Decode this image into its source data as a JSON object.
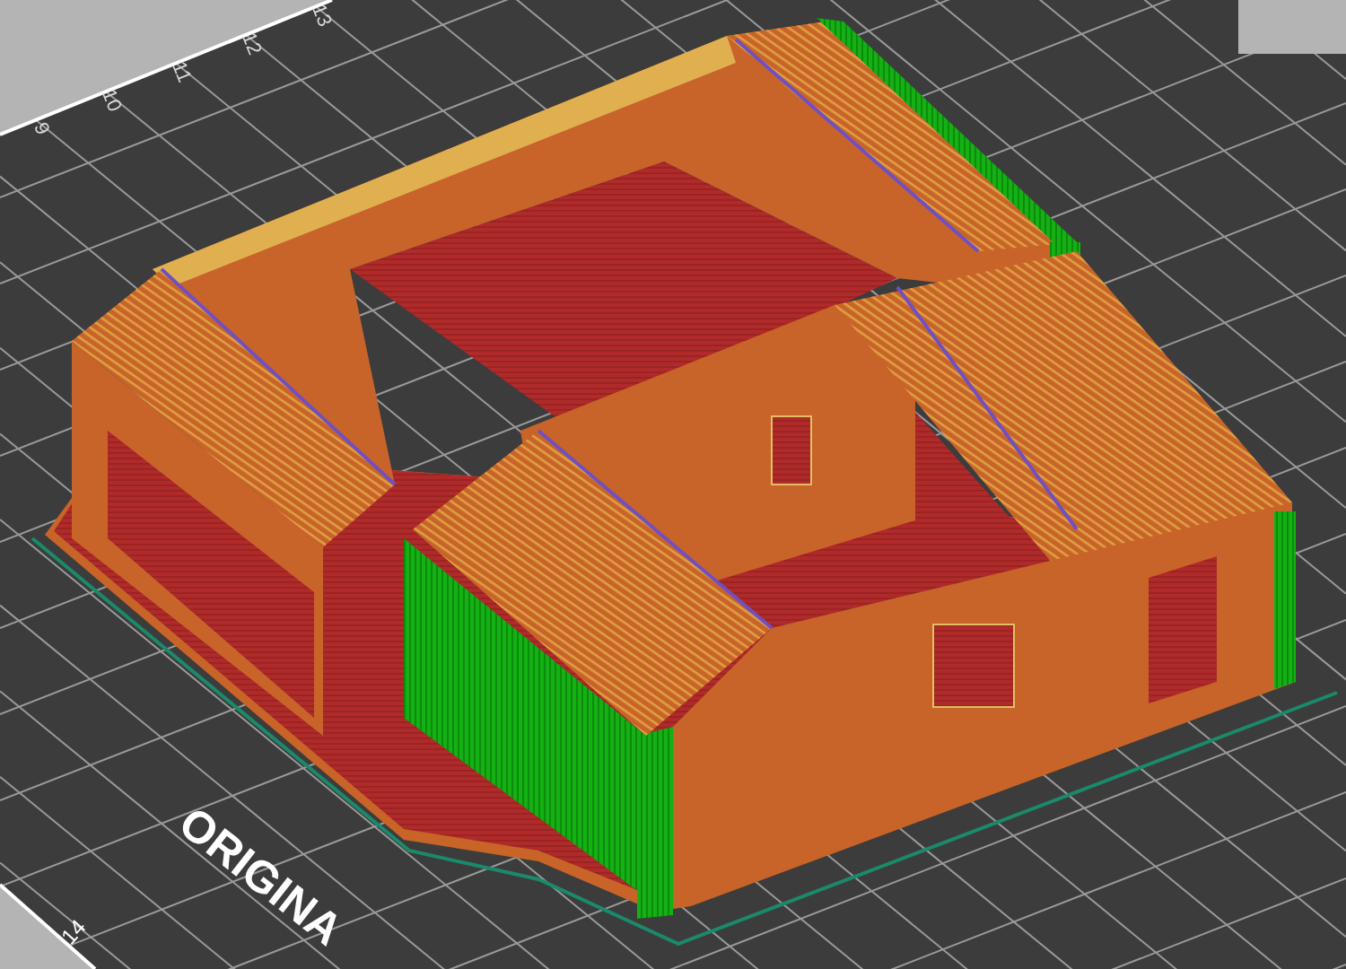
{
  "bed": {
    "scale_labels": [
      "9",
      "10",
      "11",
      "12",
      "13"
    ],
    "corner_label": "14",
    "logo_text": "ORIGINA"
  }
}
